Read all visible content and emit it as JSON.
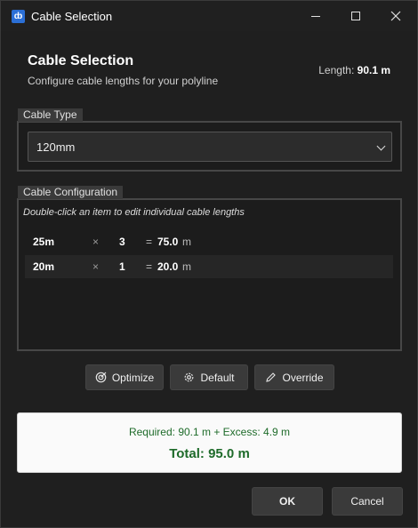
{
  "window": {
    "title": "Cable Selection",
    "app_icon_glyph": "ȸ"
  },
  "header": {
    "title": "Cable Selection",
    "subtitle": "Configure cable lengths for your polyline",
    "length_label": "Length:",
    "length_value": "90.1 m"
  },
  "cable_type": {
    "group_label": "Cable Type",
    "selected": "120mm"
  },
  "cable_config": {
    "group_label": "Cable Configuration",
    "hint": "Double-click an item to edit individual cable lengths",
    "rows": [
      {
        "length": "25m",
        "times": "×",
        "qty": "3",
        "equals": "=",
        "total": "75.0",
        "unit": "m"
      },
      {
        "length": "20m",
        "times": "×",
        "qty": "1",
        "equals": "=",
        "total": "20.0",
        "unit": "m"
      }
    ]
  },
  "actions": {
    "optimize_label": "Optimize",
    "default_label": "Default",
    "override_label": "Override"
  },
  "summary": {
    "required_line": "Required: 90.1 m + Excess: 4.9 m",
    "total_line": "Total: 95.0 m"
  },
  "dialog_buttons": {
    "ok_label": "OK",
    "cancel_label": "Cancel"
  },
  "colors": {
    "background": "#1f1f1f",
    "summary_text": "#1e6b2a",
    "accent_icon": "#2b6fd6"
  }
}
